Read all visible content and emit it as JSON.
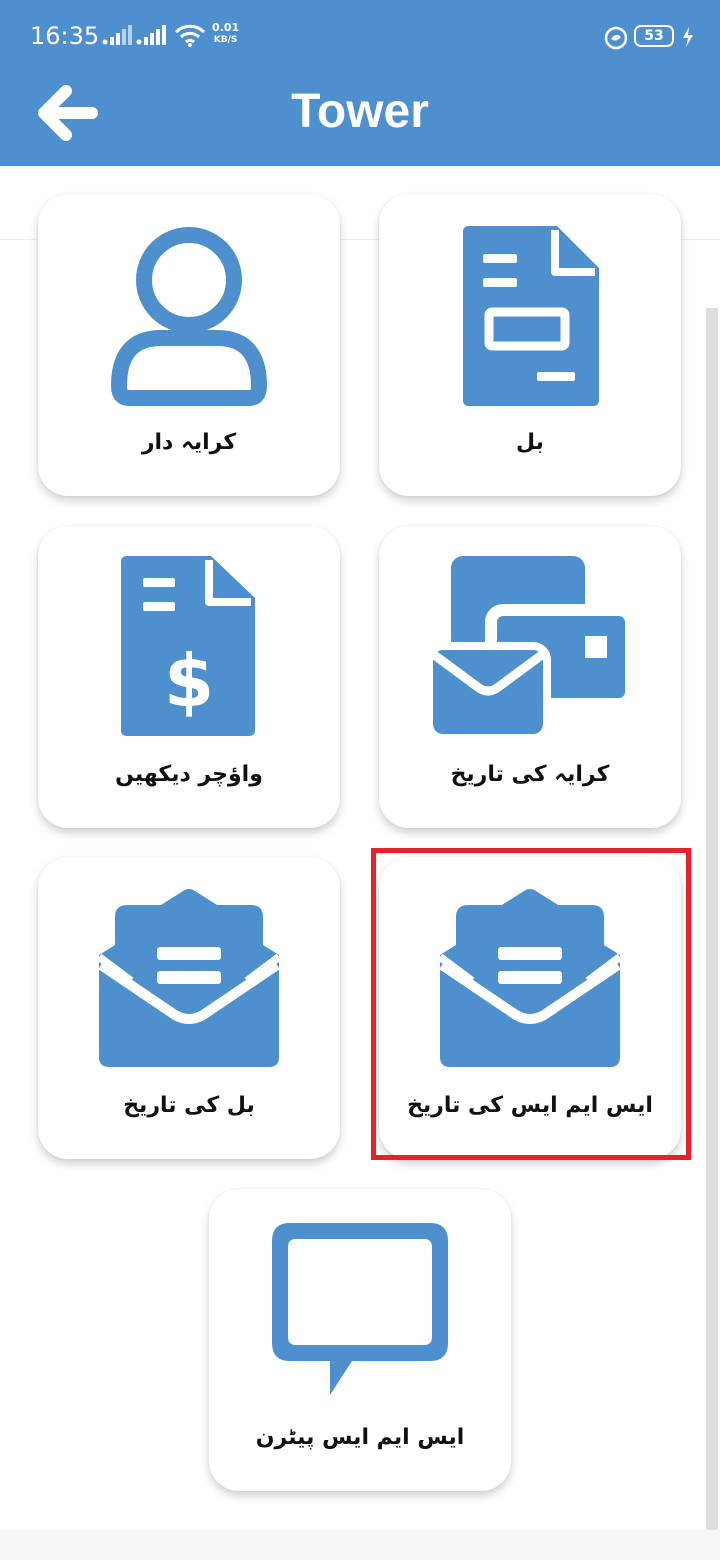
{
  "status_bar": {
    "time": "16:35",
    "net_speed_value": "0.01",
    "net_speed_unit": "KB/S",
    "battery": "53"
  },
  "header": {
    "title": "Tower"
  },
  "cards": [
    {
      "label": "کرایہ دار",
      "icon": "person-icon"
    },
    {
      "label": "بل",
      "icon": "document-icon"
    },
    {
      "label": "واؤچر دیکھیں",
      "icon": "dollar-document-icon"
    },
    {
      "label": "کرایہ کی تاریخ",
      "icon": "mail-cards-icon"
    },
    {
      "label": "بل کی تاریخ",
      "icon": "open-envelope-icon"
    },
    {
      "label": "ایس ایم ایس کی تاریخ",
      "icon": "open-envelope-icon"
    },
    {
      "label": "ایس ایم ایس پیٹرن",
      "icon": "chat-bubble-icon"
    }
  ],
  "colors": {
    "header": "#4e8fcd",
    "icon": "#4e8fcd",
    "highlight": "#e8202a"
  }
}
